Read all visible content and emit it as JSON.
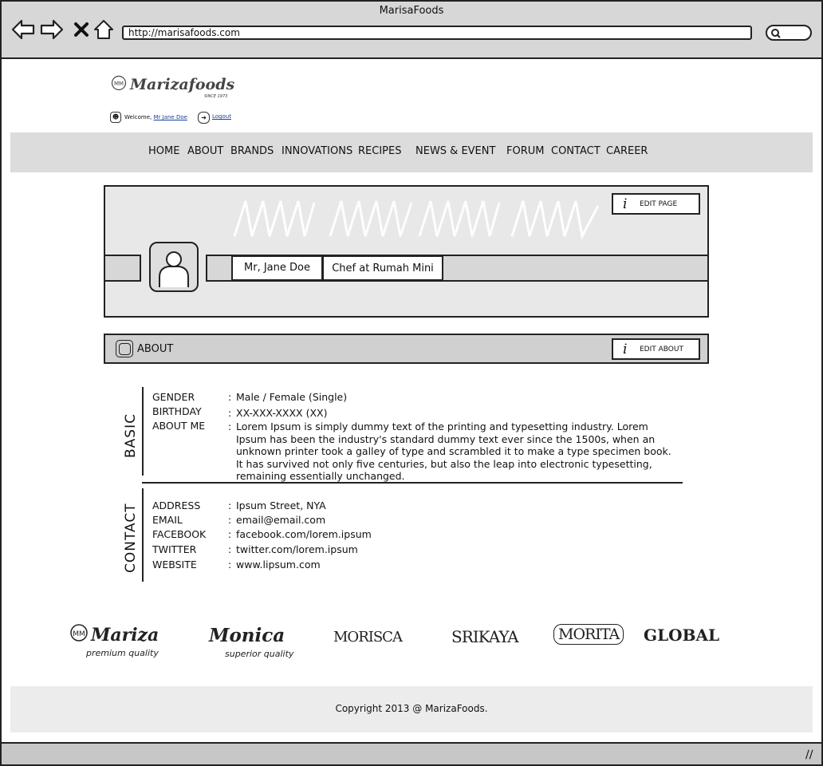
{
  "browser": {
    "title": "MarisaFoods",
    "url": "http://marisafoods.com",
    "icons": [
      "back-arrow-icon",
      "forward-arrow-icon",
      "close-icon",
      "home-icon",
      "search-icon"
    ]
  },
  "header": {
    "logo_text": "Marizafoods",
    "logo_since": "SINCE 1973",
    "welcome_prefix": "Welcome,",
    "user_link": "Mr Jane Doe",
    "logout": "Logout"
  },
  "nav": [
    "HOME",
    "ABOUT",
    "BRANDS",
    "INNOVATIONS",
    "RECIPES",
    "NEWS & EVENT",
    "FORUM",
    "CONTACT",
    "CAREER"
  ],
  "profile": {
    "edit_page": "EDIT PAGE",
    "name": "Mr, Jane Doe",
    "job": "Chef at Rumah Mini"
  },
  "about_bar": {
    "title": "ABOUT",
    "edit_about": "EDIT ABOUT"
  },
  "basic": {
    "section_title": "BASIC",
    "gender_label": "GENDER",
    "gender": "Male / Female (Single)",
    "birthday_label": "BIRTHDAY",
    "birthday": "XX-XXX-XXXX (XX)",
    "about_label": "ABOUT ME",
    "about": "Lorem Ipsum is simply dummy text of the printing and typesetting industry. Lorem Ipsum has been the industry's standard dummy text ever since the 1500s, when an unknown printer took a galley of type and scrambled it to make a type specimen book. It has survived not only five centuries, but also the leap into electronic typesetting, remaining essentially unchanged."
  },
  "contact": {
    "section_title": "CONTACT",
    "address_label": "ADDRESS",
    "address": "Ipsum Street, NYA",
    "email_label": "EMAIL",
    "email": "email@email.com",
    "facebook_label": "FACEBOOK",
    "facebook": "facebook.com/lorem.ipsum",
    "twitter_label": "TWITTER",
    "twitter": "twitter.com/lorem.ipsum",
    "website_label": "WEBSITE",
    "website": "www.lipsum.com"
  },
  "brands": {
    "mariza": "Mariza",
    "mariza_sub": "premium quality",
    "monica": "Monica",
    "monica_sub": "superior quality",
    "morisca": "MORISCA",
    "srikaya": "SRIKAYA",
    "morita": "MORITA",
    "global": "GLOBAL"
  },
  "footer": {
    "copyright": "Copyright 2013 @ MarizaFoods."
  }
}
